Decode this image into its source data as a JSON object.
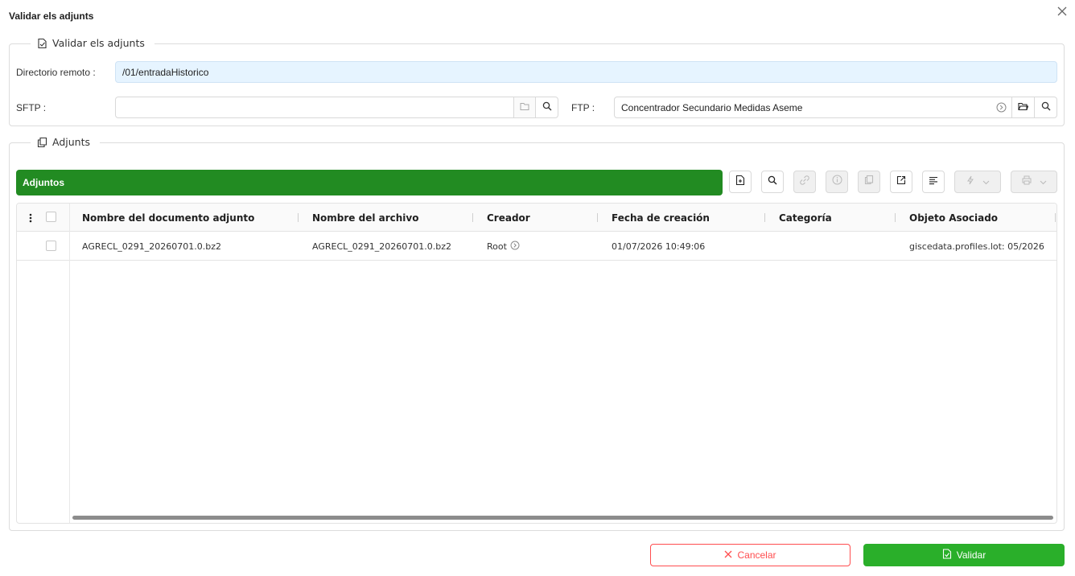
{
  "dialog": {
    "title": "Validar els adjunts"
  },
  "validate_group": {
    "legend": "Validar els adjunts",
    "remote_dir_label": "Directorio remoto :",
    "remote_dir_value": "/01/entradaHistorico",
    "sftp_label": "SFTP :",
    "sftp_value": "",
    "ftp_label": "FTP :",
    "ftp_value": "Concentrador Secundario Medidas Aseme"
  },
  "attachments_group": {
    "legend": "Adjunts",
    "toolbar_title": "Adjuntos",
    "toolbar_icons": [
      "new-document-icon",
      "search-icon",
      "link-icon",
      "info-icon",
      "duplicate-icon",
      "open-external-icon",
      "align-left-icon",
      "lightning-icon",
      "print-icon"
    ]
  },
  "table": {
    "columns": [
      "Nombre del documento adjunto",
      "Nombre del archivo",
      "Creador",
      "Fecha de creación",
      "Categoría",
      "Objeto Asociado"
    ],
    "rows": [
      {
        "document_name": "AGRECL_0291_20260701.0.bz2",
        "file_name": "AGRECL_0291_20260701.0.bz2",
        "creator": "Root",
        "created_at": "01/07/2026 10:49:06",
        "category": "",
        "associated_object": "giscedata.profiles.lot: 05/2026"
      }
    ]
  },
  "footer": {
    "cancel_label": "Cancelar",
    "validate_label": "Validar"
  },
  "colors": {
    "green_bar": "#228b22",
    "validate_button": "#2aaf2a",
    "cancel": "#ff4d4f",
    "readonly_input": "#e6f4ff"
  }
}
